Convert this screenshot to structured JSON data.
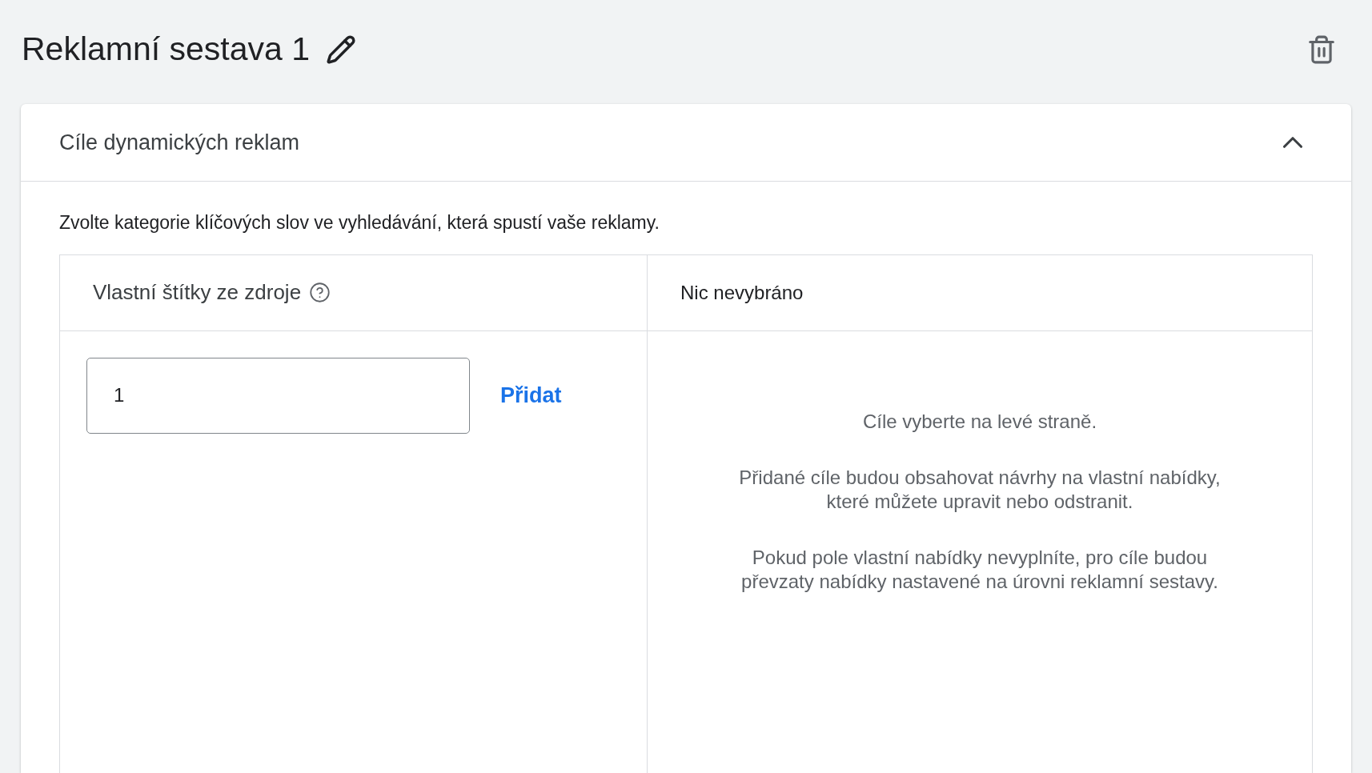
{
  "title": "Reklamní sestava 1",
  "section": {
    "title": "Cíle dynamických reklam",
    "expanded": true,
    "description": "Zvolte kategorie klíčových slov ve vyhledávání, která spustí vaše reklamy.",
    "source_panel": {
      "heading": "Vlastní štítky ze zdroje",
      "input": {
        "value": "1"
      },
      "add_button": "Přidat"
    },
    "selection_panel": {
      "heading": "Nic nevybráno",
      "messages": [
        "Cíle vyberte na levé straně.",
        "Přidané cíle budou obsahovat návrhy na vlastní nabídky, které můžete upravit nebo odstranit.",
        "Pokud pole vlastní nabídky nevyplníte, pro cíle budou převzaty nabídky nastavené na úrovni reklamní sestavy."
      ]
    }
  }
}
